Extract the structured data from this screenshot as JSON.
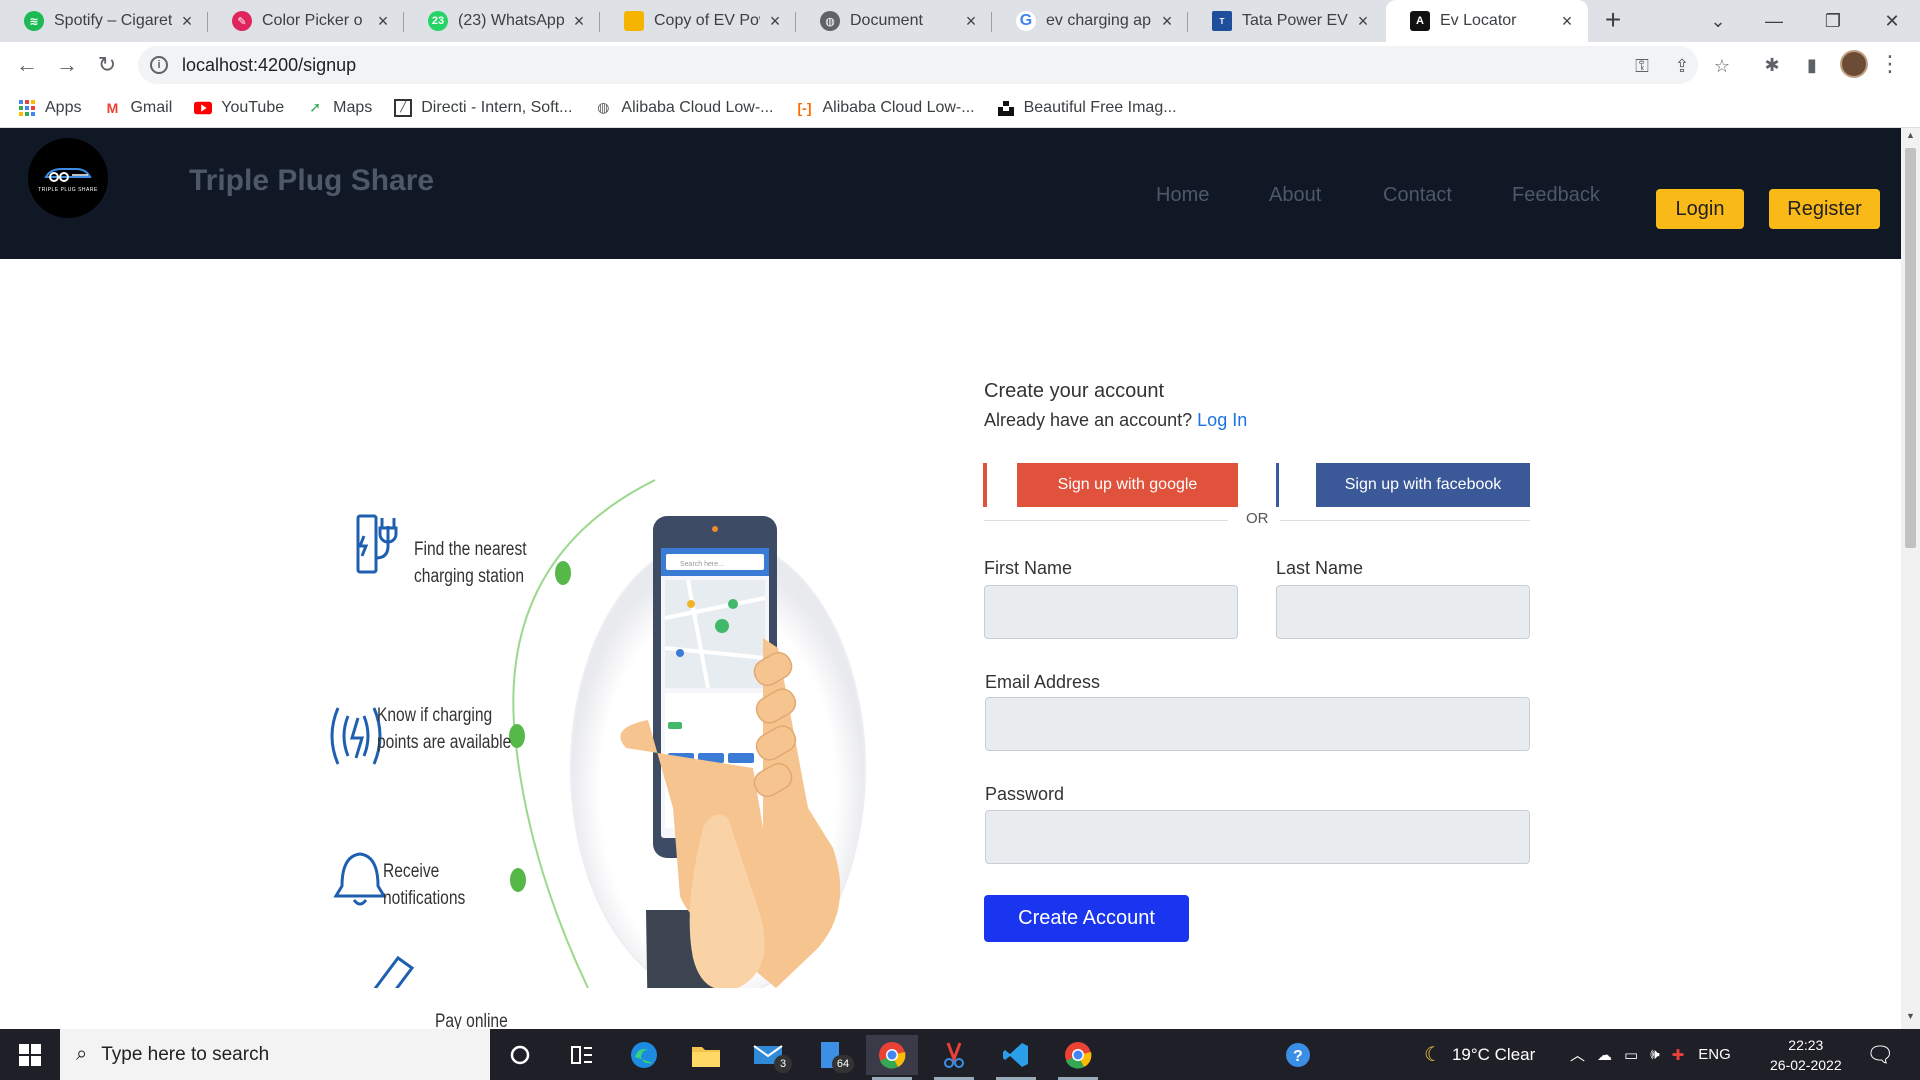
{
  "browser": {
    "tabs": [
      {
        "title": "Spotify – Cigarett",
        "fav": "spotify",
        "color": "#1db954"
      },
      {
        "title": "Color Picker o",
        "fav": "color-picker",
        "color": "#e0245e"
      },
      {
        "title": "(23) WhatsApp",
        "fav": "whatsapp",
        "color": "#25d366",
        "badge": "23"
      },
      {
        "title": "Copy of EV Powe",
        "fav": "slides",
        "color": "#f4b400"
      },
      {
        "title": "Document",
        "fav": "globe",
        "color": "#5f6368"
      },
      {
        "title": "ev charging app",
        "fav": "google",
        "color": "#4285f4"
      },
      {
        "title": "Tata Power EV Ch",
        "fav": "tata",
        "color": "#1f4e9c"
      },
      {
        "title": "Ev Locator",
        "fav": "angular",
        "color": "#111111"
      }
    ],
    "url": "localhost:4200/signup",
    "bookmarks": [
      {
        "label": "Apps",
        "icon": "apps-grid"
      },
      {
        "label": "Gmail",
        "icon": "gmail"
      },
      {
        "label": "YouTube",
        "icon": "youtube"
      },
      {
        "label": "Maps",
        "icon": "maps"
      },
      {
        "label": "Directi - Intern, Soft...",
        "icon": "directi"
      },
      {
        "label": "Alibaba Cloud Low-...",
        "icon": "globe"
      },
      {
        "label": "Alibaba Cloud Low-...",
        "icon": "alibaba"
      },
      {
        "label": "Beautiful Free Imag...",
        "icon": "unsplash"
      }
    ]
  },
  "site": {
    "brand": "Triple Plug Share",
    "logo_text": "TRIPLE PLUG SHARE",
    "nav": [
      "Home",
      "About",
      "Contact",
      "Feedback"
    ],
    "login": "Login",
    "register": "Register"
  },
  "illustration": {
    "features": [
      "Find the nearest\ncharging station",
      "Know if charging\npoints are available",
      "Receive\nnotifications",
      "Pay online"
    ],
    "phone_search": "Search here..."
  },
  "signup": {
    "title": "Create your account",
    "have_account": "Already have an account?",
    "login_link": "Log In",
    "google": "Sign up with google",
    "facebook": "Sign up with facebook",
    "or": "OR",
    "first_name": "First Name",
    "last_name": "Last Name",
    "email": "Email Address",
    "password": "Password",
    "submit": "Create Account"
  },
  "taskbar": {
    "search_placeholder": "Type here to search",
    "weather": "19°C  Clear",
    "lang": "ENG",
    "time": "22:23",
    "date": "26-02-2022",
    "mail_badge": "3",
    "files_badge": "64"
  },
  "colors": {
    "header_bg": "#101725",
    "accent_yellow": "#f9b917",
    "google_red": "#e0523c",
    "facebook_blue": "#3b5998",
    "cta_blue": "#1a35f0"
  }
}
